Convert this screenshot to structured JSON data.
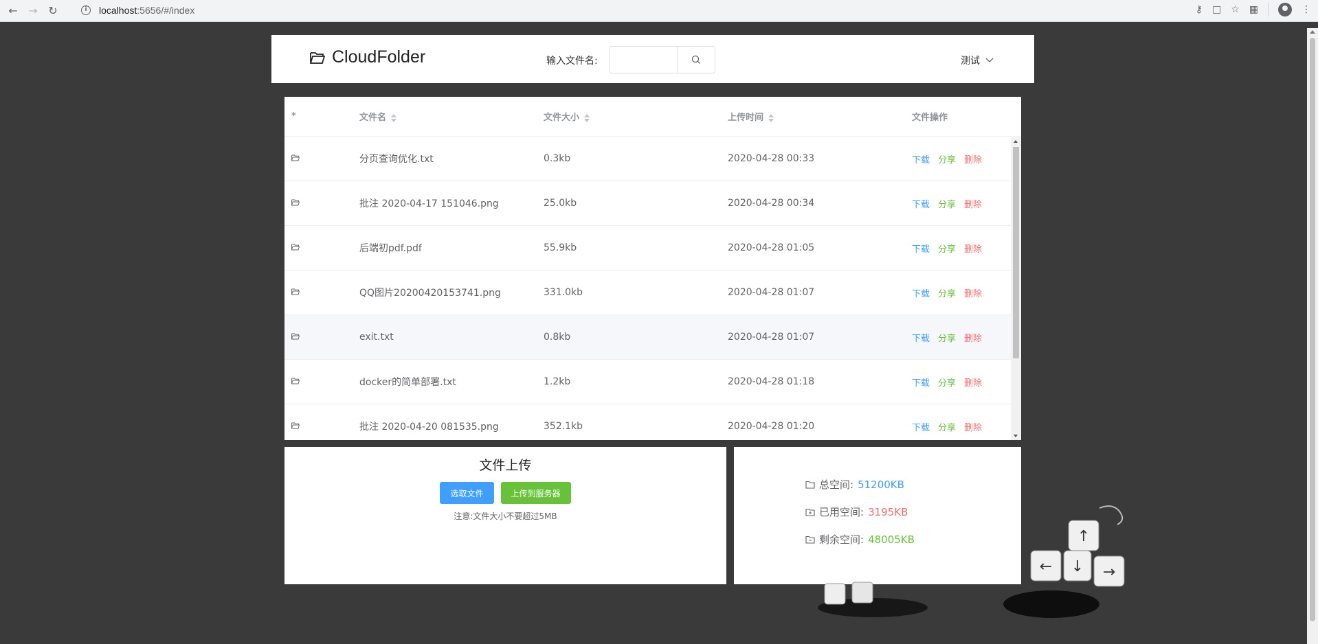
{
  "browser": {
    "url_host": "localhost",
    "url_path": ":5656/#/index"
  },
  "header": {
    "app_name": "CloudFolder",
    "search_label": "输入文件名:",
    "search_value": "",
    "user_name": "测试"
  },
  "table": {
    "columns": [
      "*",
      "文件名",
      "文件大小",
      "上传时间",
      "文件操作"
    ],
    "actions": {
      "download": "下载",
      "share": "分享",
      "delete": "删除"
    },
    "rows": [
      {
        "name": "分页查询优化.txt",
        "size": "0.3kb",
        "time": "2020-04-28 00:33"
      },
      {
        "name": "批注 2020-04-17 151046.png",
        "size": "25.0kb",
        "time": "2020-04-28 00:34"
      },
      {
        "name": "后端初pdf.pdf",
        "size": "55.9kb",
        "time": "2020-04-28 01:05"
      },
      {
        "name": "QQ图片20200420153741.png",
        "size": "331.0kb",
        "time": "2020-04-28 01:07"
      },
      {
        "name": "exit.txt",
        "size": "0.8kb",
        "time": "2020-04-28 01:07"
      },
      {
        "name": "docker的简单部署.txt",
        "size": "1.2kb",
        "time": "2020-04-28 01:18"
      },
      {
        "name": "批注 2020-04-20 081535.png",
        "size": "352.1kb",
        "time": "2020-04-28 01:20"
      }
    ]
  },
  "upload": {
    "title": "文件上传",
    "select_label": "选取文件",
    "upload_label": "上传到服务器",
    "tip": "注意:文件大小不要超过5MB"
  },
  "space": {
    "total_label": "总空间:",
    "total_value": "51200KB",
    "used_label": "已用空间:",
    "used_value": "3195KB",
    "free_label": "剩余空间:",
    "free_value": "48005KB"
  },
  "colors": {
    "primary": "#409eff",
    "success": "#67c23a",
    "danger": "#f56c6c",
    "background": "#3a3a3a"
  }
}
